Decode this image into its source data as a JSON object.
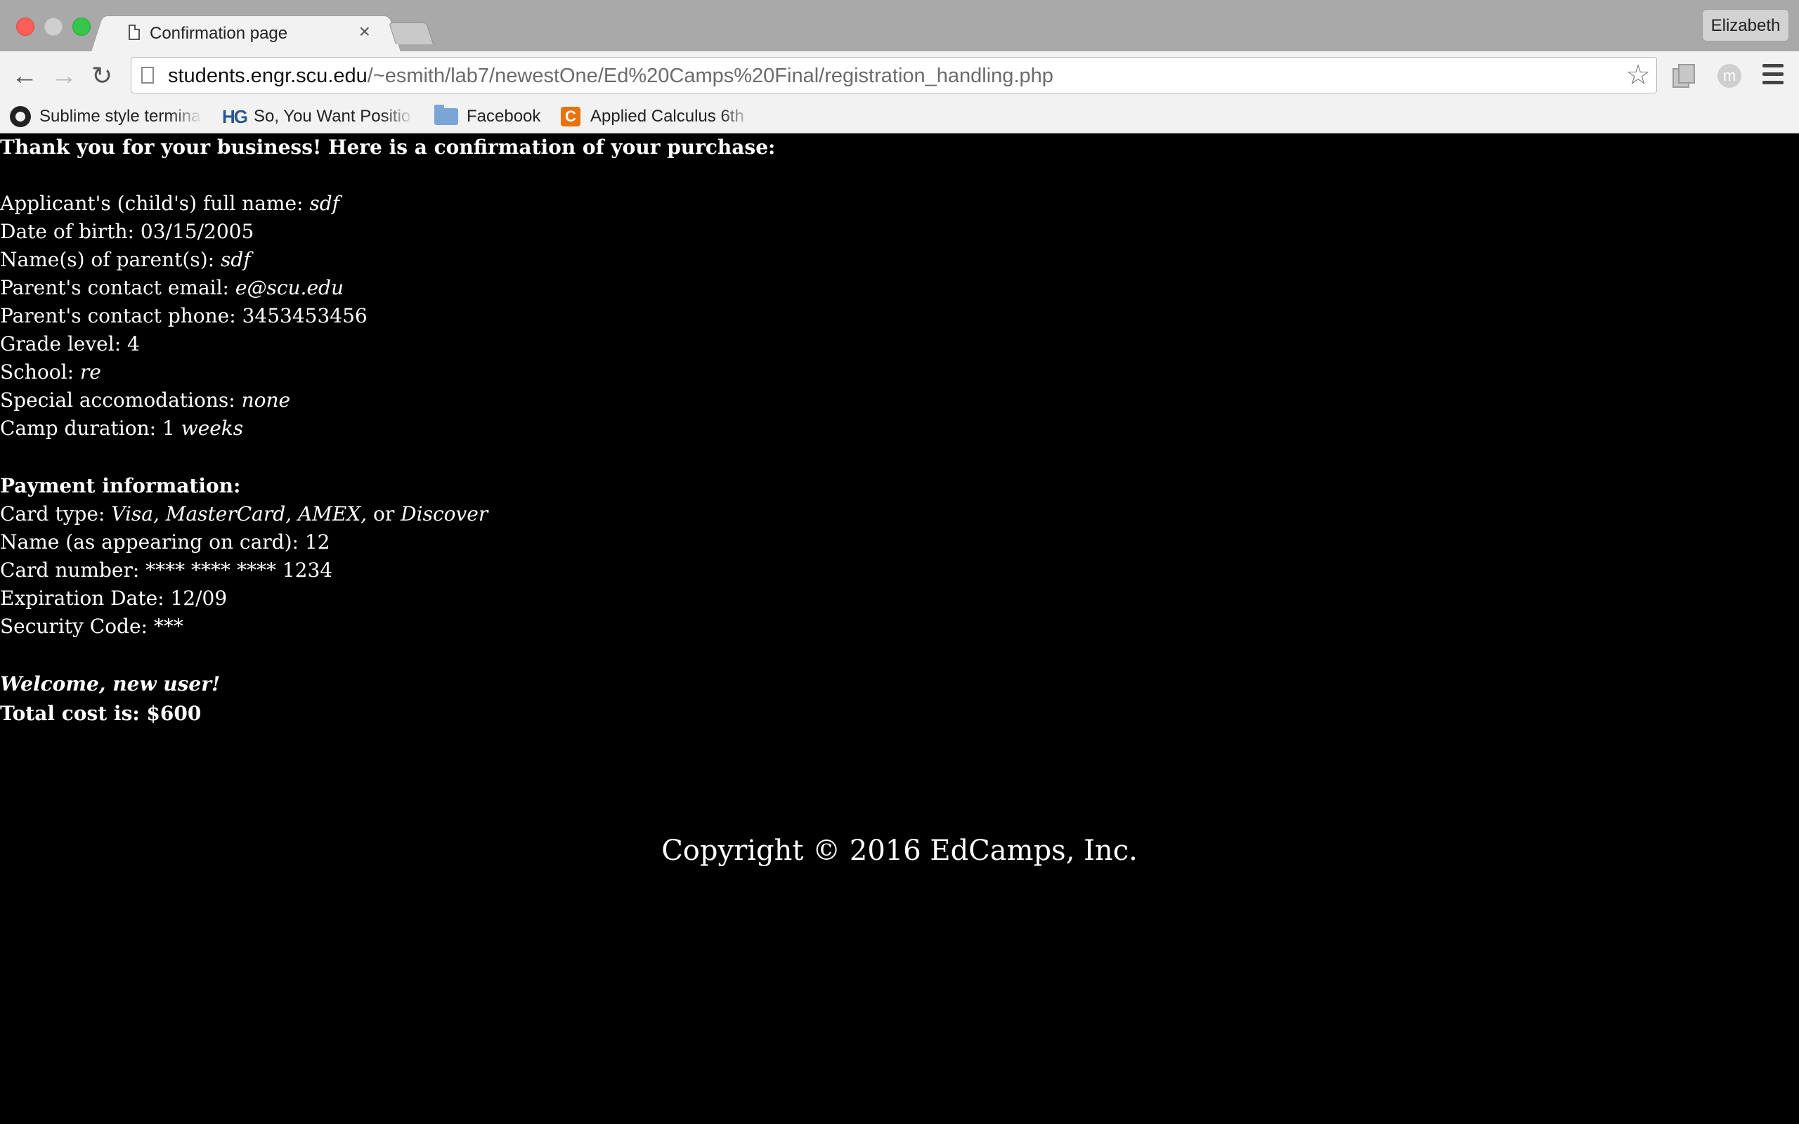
{
  "browser": {
    "tab_title": "Confirmation page",
    "tab_close": "×",
    "profile_name": "Elizabeth",
    "url_host": "students.engr.scu.edu",
    "url_path": "/~esmith/lab7/newestOne/Ed%20Camps%20Final/registration_handling.php",
    "nav_icons": {
      "back": "←",
      "forward": "→",
      "reload": "↻",
      "star": "☆",
      "ext2_letter": "m"
    },
    "bookmarks": [
      {
        "label": "Sublime style termina",
        "icon": "github-icon"
      },
      {
        "label": "So, You Want Positio",
        "icon": "hg-icon",
        "icon_text": "HG"
      },
      {
        "label": "Facebook",
        "icon": "folder-icon"
      },
      {
        "label": "Applied Calculus 6th",
        "icon": "c-icon",
        "icon_text": "C"
      }
    ]
  },
  "confirmation": {
    "heading": "Thank you for your business! Here is a confirmation of your purchase:",
    "fields": [
      {
        "label": "Applicant's (child's) full name: ",
        "value": "sdf",
        "italic": true
      },
      {
        "label": "Date of birth: ",
        "value": "03/15/2005",
        "italic": false
      },
      {
        "label": "Name(s) of parent(s): ",
        "value": "sdf",
        "italic": true
      },
      {
        "label": "Parent's contact email: ",
        "value": "e@scu.edu",
        "italic": true
      },
      {
        "label": "Parent's contact phone: ",
        "value": "3453453456",
        "italic": false
      },
      {
        "label": "Grade level: ",
        "value": "4",
        "italic": false
      },
      {
        "label": "School: ",
        "value": "re",
        "italic": true
      },
      {
        "label": "Special accomodations: ",
        "value": "none",
        "italic": true
      },
      {
        "label": "Camp duration: ",
        "value": "1",
        "suffix": " weeks",
        "italic": false
      }
    ],
    "payment_heading": "Payment information:",
    "payment": [
      {
        "label": "Card type: ",
        "value": "Visa, MasterCard, AMEX,",
        "connector": " or ",
        "value2": "Discover"
      },
      {
        "label": "Name (as appearing on card): ",
        "value": "12"
      },
      {
        "label": "Card number: ",
        "value": "**** **** **** 1234"
      },
      {
        "label": "Expiration Date: ",
        "value": "12/09"
      },
      {
        "label": "Security Code: ",
        "value": "***"
      }
    ],
    "welcome": "Welcome, new user!",
    "total": "Total cost is: $600"
  },
  "footer": {
    "copyright": "Copyright © 2016 EdCamps, Inc."
  }
}
